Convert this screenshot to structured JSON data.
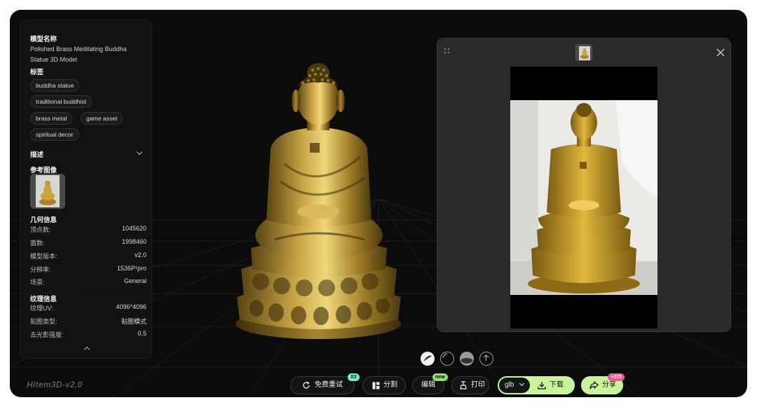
{
  "panel": {
    "model_name_title": "模型名称",
    "model_name": "Polished Brass Meditating Buddha Statue 3D Model",
    "tags_title": "标签",
    "tags": [
      "buddha statue",
      "traditional buddhist",
      "brass metal",
      "game asset",
      "spiritual decor"
    ],
    "description_title": "描述",
    "reference_title": "参考图像",
    "geometry_title": "几何信息",
    "geometry": [
      {
        "label": "顶点数:",
        "value": "1045620"
      },
      {
        "label": "面数:",
        "value": "1998460"
      },
      {
        "label": "模型版本:",
        "value": "v2.0"
      },
      {
        "label": "分辨率:",
        "value": "1536P¹pro"
      },
      {
        "label": "场景:",
        "value": "General"
      }
    ],
    "texture_title": "纹理信息",
    "texture": [
      {
        "label": "纹理UV:",
        "value": "4096*4096"
      },
      {
        "label": "贴图类型:",
        "value": "贴图模式"
      },
      {
        "label": "去光影强度:",
        "value": "0.5"
      }
    ]
  },
  "toolbar": {
    "retry_label": "免费重试",
    "retry_badge": "X3",
    "split_label": "分割",
    "edit_label": "编辑",
    "edit_badge": "new",
    "print_label": "打印",
    "format_value": "glb",
    "download_label": "下载",
    "share_label": "分享",
    "share_badge": "+375"
  },
  "watermark": "Hitem3D-v2.0",
  "colors": {
    "background": "#0b0b0b",
    "panel": "#141414",
    "accent_green": "#c8f59a",
    "badge_pink": "#e85d9a",
    "brass": "#b89432"
  },
  "icons": [
    "drag-handle-icon",
    "close-icon",
    "chevron-down-icon",
    "chevron-up-icon",
    "refresh-icon",
    "split-icon",
    "print-icon",
    "download-icon",
    "share-icon",
    "render-mode-icon"
  ]
}
